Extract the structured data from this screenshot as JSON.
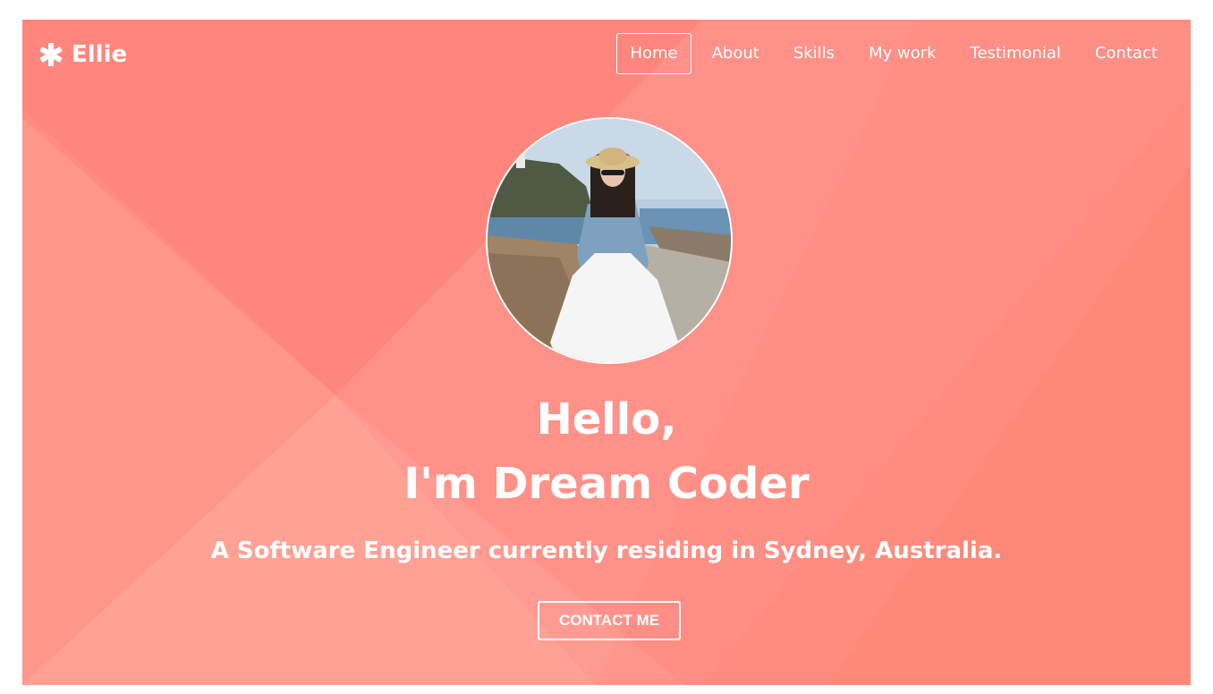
{
  "brand": {
    "icon": "star-icon",
    "name": "Ellie"
  },
  "nav": {
    "items": [
      {
        "label": "Home",
        "active": true
      },
      {
        "label": "About",
        "active": false
      },
      {
        "label": "Skills",
        "active": false
      },
      {
        "label": "My work",
        "active": false
      },
      {
        "label": "Testimonial",
        "active": false
      },
      {
        "label": "Contact",
        "active": false
      }
    ]
  },
  "hero": {
    "greeting": "Hello,",
    "headline": "I'm Dream Coder",
    "description": "A Software Engineer currently residing in Sydney, Australia.",
    "cta_label": "CONTACT ME"
  },
  "colors": {
    "background": "#fe8c81",
    "text": "#ffffff"
  }
}
